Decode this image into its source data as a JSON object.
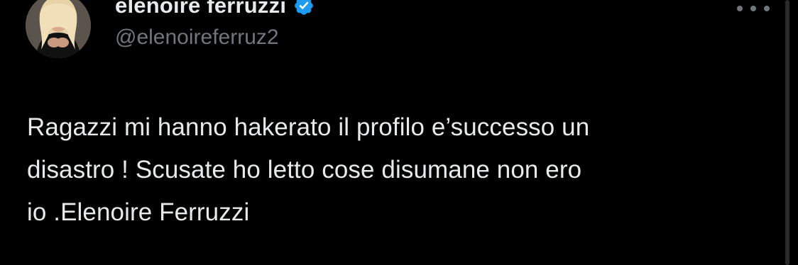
{
  "tweet": {
    "author": {
      "display_name": "elenoire ferruzzi",
      "handle": "@elenoireferruz2",
      "verified": true,
      "verified_badge_color": "#1d9bf0"
    },
    "text": "Ragazzi mi hanno hakerato il profilo e’successo un\ndisastro ! Scusate ho letto cose disumane non ero\nio .Elenoire Ferruzzi",
    "more_icon": "more-horizontal-icon"
  },
  "theme": {
    "background": "#000000",
    "primary_text": "#e7e9ea",
    "secondary_text": "#71767b"
  }
}
